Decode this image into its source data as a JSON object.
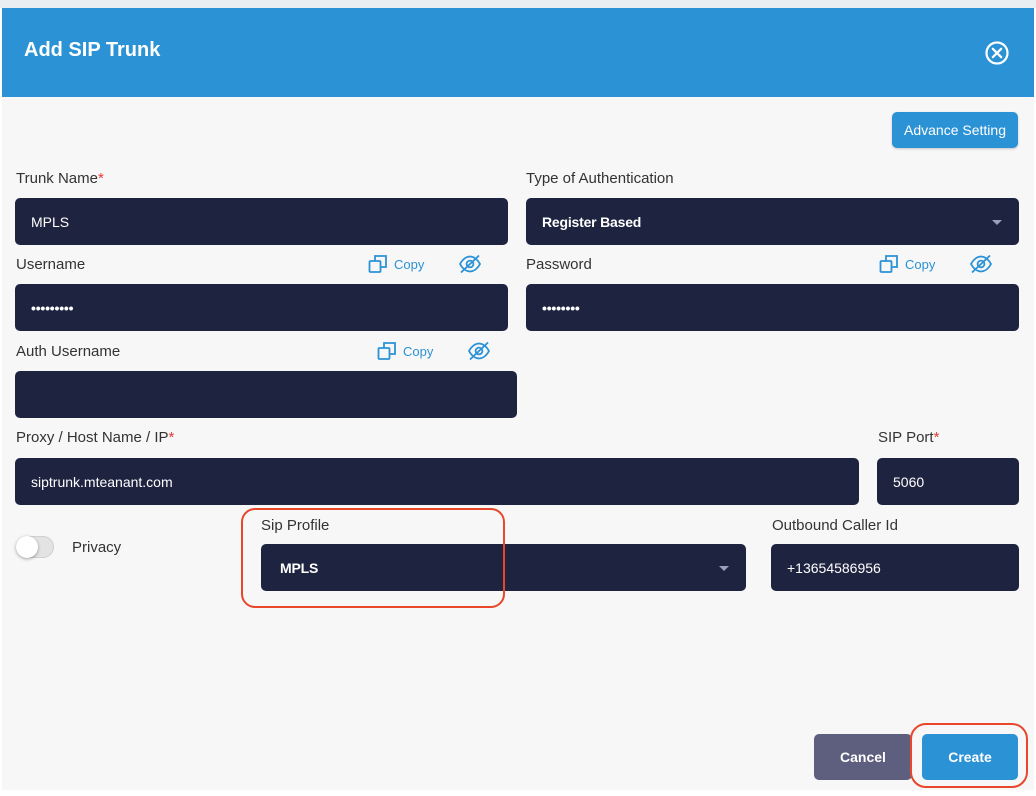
{
  "modal": {
    "title": "Add SIP Trunk",
    "advance_setting_label": "Advance Setting"
  },
  "form": {
    "trunk_name": {
      "label": "Trunk Name",
      "required_mark": "*",
      "value": "MPLS"
    },
    "auth_type": {
      "label": "Type of Authentication",
      "value": "Register Based"
    },
    "username": {
      "label": "Username",
      "value": "•••••••••",
      "copy_label": "Copy"
    },
    "password": {
      "label": "Password",
      "value": "••••••••",
      "copy_label": "Copy"
    },
    "auth_username": {
      "label": "Auth Username",
      "value": "",
      "copy_label": "Copy"
    },
    "proxy": {
      "label": "Proxy / Host Name / IP",
      "required_mark": "*",
      "value": "siptrunk.mteanant.com"
    },
    "sip_port": {
      "label": "SIP Port",
      "required_mark": "*",
      "value": "5060"
    },
    "privacy": {
      "label": "Privacy",
      "enabled": false
    },
    "sip_profile": {
      "label": "Sip Profile",
      "value": "MPLS"
    },
    "outbound_caller_id": {
      "label": "Outbound Caller Id",
      "value": "+13654586956"
    }
  },
  "footer": {
    "cancel_label": "Cancel",
    "create_label": "Create"
  },
  "colors": {
    "header": "#2b92d6",
    "field_bg": "#1e2340",
    "highlight": "#e8472b"
  },
  "icons": [
    "close-circle-icon",
    "copy-icon",
    "eye-slash-icon",
    "chevron-down-icon"
  ]
}
